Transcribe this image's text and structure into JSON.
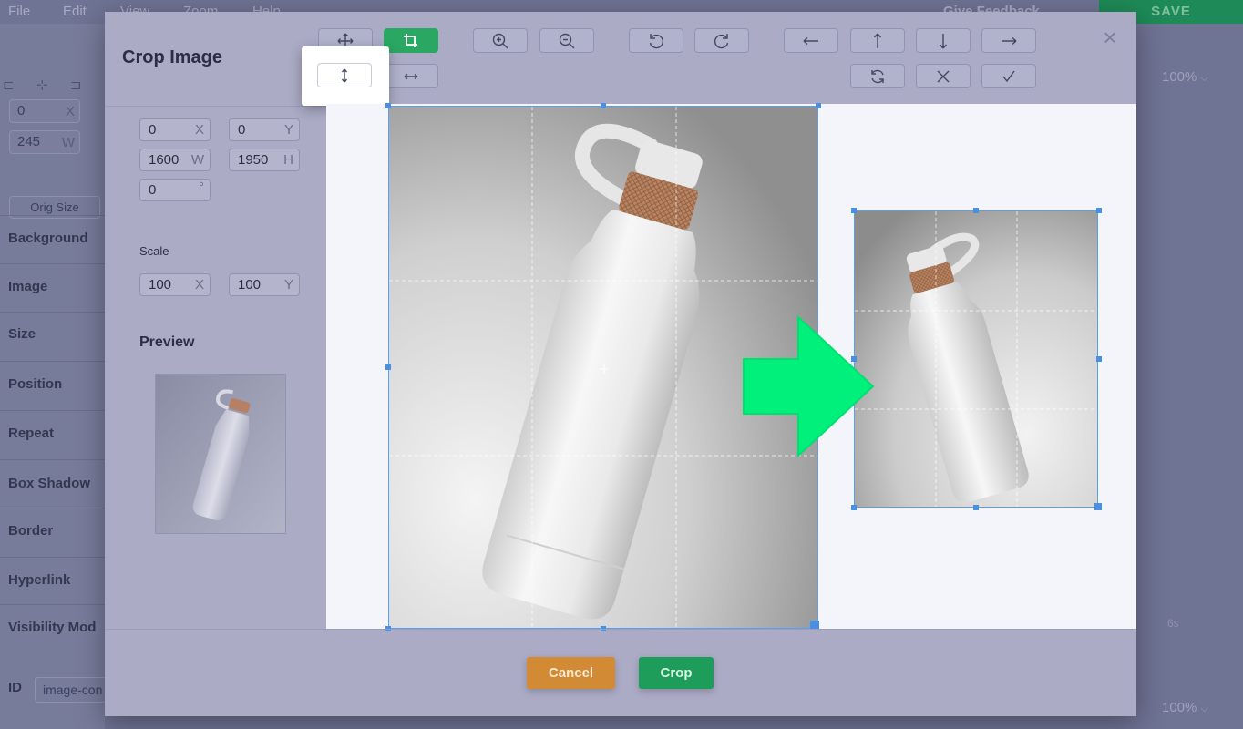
{
  "menubar": {
    "items": [
      "File",
      "Edit",
      "View",
      "Zoom",
      "Help"
    ],
    "feedback": "Give Feedback",
    "save": "SAVE"
  },
  "bg_panel": {
    "x_value": "0",
    "x_unit": "X",
    "w_value": "245",
    "w_unit": "W",
    "orig_size": "Orig Size",
    "sections": [
      "Background",
      "Image",
      "Size",
      "Position",
      "Repeat",
      "Box Shadow",
      "Border",
      "Hyperlink",
      "Visibility Mod"
    ],
    "id_label": "ID",
    "id_value": "image-con"
  },
  "right_panel": {
    "zoom_top": "100%",
    "zoom_bottom": "100%",
    "timeline_tick": "6s"
  },
  "modal": {
    "title": "Crop Image",
    "close": "×",
    "fields": {
      "x": {
        "value": "0",
        "unit": "X"
      },
      "y": {
        "value": "0",
        "unit": "Y"
      },
      "w": {
        "value": "1600",
        "unit": "W"
      },
      "h": {
        "value": "1950",
        "unit": "H"
      },
      "rotate": {
        "value": "0",
        "unit": "°"
      }
    },
    "scale_label": "Scale",
    "scale": {
      "x": {
        "value": "100",
        "unit": "X"
      },
      "y": {
        "value": "100",
        "unit": "Y"
      }
    },
    "preview_label": "Preview",
    "toolbar_icons": [
      "move-icon",
      "crop-icon",
      "flip-vertical-icon",
      "flip-horizontal-icon",
      "zoom-in-icon",
      "zoom-out-icon",
      "rotate-left-icon",
      "rotate-right-icon",
      "arrow-left-icon",
      "arrow-up-icon",
      "arrow-down-icon",
      "arrow-right-icon",
      "reset-icon",
      "clear-icon",
      "check-icon"
    ],
    "cancel": "Cancel",
    "crop": "Crop"
  },
  "colors": {
    "accent_green": "#2aa863",
    "cancel_orange": "#d28b34",
    "crop_box_blue": "#5aa0f0",
    "arrow_green": "#00f07c"
  }
}
